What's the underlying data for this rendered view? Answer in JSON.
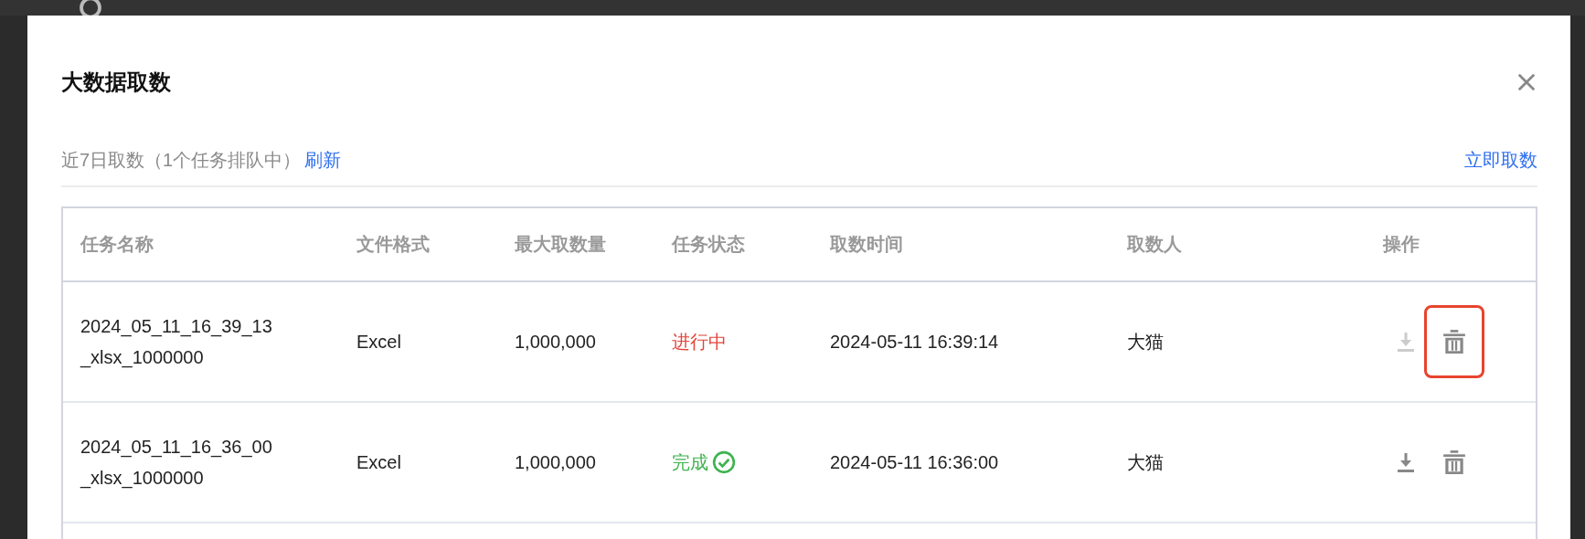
{
  "dialog": {
    "title": "大数据取数",
    "summary": "近7日取数（1个任务排队中）",
    "refresh_link": "刷新",
    "fetch_now_link": "立即取数"
  },
  "table": {
    "columns": [
      "任务名称",
      "文件格式",
      "最大取数量",
      "任务状态",
      "取数时间",
      "取数人",
      "操作"
    ],
    "rows": [
      {
        "name": "2024_05_11_16_39_13\n_xlsx_1000000",
        "format": "Excel",
        "max_count": "1,000,000",
        "status": {
          "kind": "running",
          "label": "进行中"
        },
        "time": "2024-05-11 16:39:14",
        "user": "大猫",
        "download_disabled": true,
        "delete_highlighted": true
      },
      {
        "name": "2024_05_11_16_36_00\n_xlsx_1000000",
        "format": "Excel",
        "max_count": "1,000,000",
        "status": {
          "kind": "done",
          "label": "完成"
        },
        "time": "2024-05-11 16:36:00",
        "user": "大猫",
        "download_disabled": false,
        "delete_highlighted": false
      }
    ]
  }
}
